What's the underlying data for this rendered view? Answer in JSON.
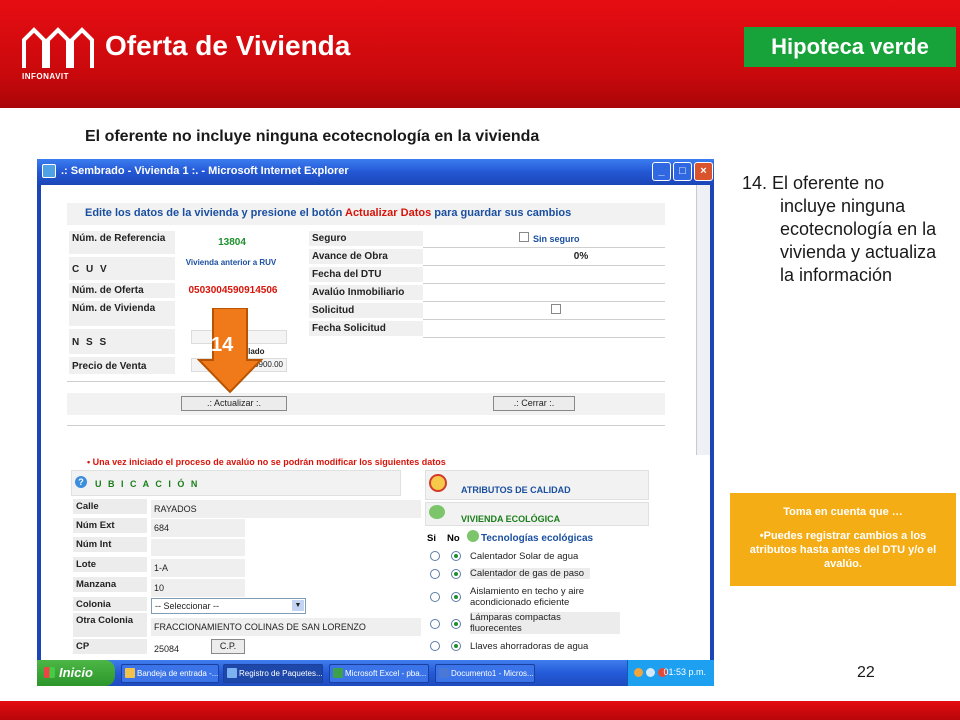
{
  "header": {
    "logo_text": "INFONAVIT",
    "title": "Oferta de Vivienda",
    "badge": "Hipoteca verde",
    "colors": {
      "header_red": "#d40b0f",
      "badge_green": "#17a33a"
    }
  },
  "subtitle": "El oferente no incluye ninguna ecotecnología en la vivienda",
  "ie_window": {
    "title": ".: Sembrado - Vivienda 1 :. - Microsoft Internet Explorer",
    "instruction_prefix": "Edite los datos de la vivienda y presione el botón",
    "instruction_highlight": "Actualizar Datos",
    "instruction_suffix": "para guardar sus cambios",
    "fields_left": [
      {
        "label": "Núm. de Referencia",
        "value": "13804"
      },
      {
        "label": "C U V",
        "value": "Vivienda anterior a RUV"
      },
      {
        "label": "Núm. de Oferta",
        "value": "0503004590914506"
      },
      {
        "label": "Núm. de Vivienda",
        "value": ""
      },
      {
        "label": "N S S",
        "value": "sin vinculado"
      },
      {
        "label": "Precio de Venta",
        "value": "60900.00"
      }
    ],
    "fields_right": [
      {
        "label": "Seguro",
        "value": "Sin seguro"
      },
      {
        "label": "Avance de Obra",
        "value": "0%"
      },
      {
        "label": "Fecha del DTU",
        "value": ""
      },
      {
        "label": "Avalúo Inmobiliario",
        "value": ""
      },
      {
        "label": "Solicitud",
        "value": ""
      },
      {
        "label": "Fecha Solicitud",
        "value": ""
      }
    ],
    "buttons": {
      "update": ".: Actualizar :.",
      "close": ".: Cerrar :."
    },
    "warning": "Una vez iniciado el proceso de avalúo no se podrán modificar los siguientes datos",
    "location": {
      "title": "U B I C A C I Ó N",
      "fields": [
        {
          "label": "Calle",
          "value": "RAYADOS"
        },
        {
          "label": "Núm Ext",
          "value": "684"
        },
        {
          "label": "Núm Int",
          "value": ""
        },
        {
          "label": "Lote",
          "value": "1-A"
        },
        {
          "label": "Manzana",
          "value": "10"
        },
        {
          "label": "Colonia",
          "value": "-- Seleccionar --"
        },
        {
          "label": "Otra Colonia",
          "value": "FRACCIONAMIENTO COLINAS DE SAN LORENZO"
        },
        {
          "label": "CP",
          "value": "25084"
        }
      ],
      "cp_button": "C.P."
    },
    "attributes": {
      "quality_title": "ATRIBUTOS DE CALIDAD",
      "eco_title": "VIVIENDA ECOLÓGICA",
      "col_yes": "Si",
      "col_no": "No",
      "tech_header": "Tecnologías ecológicas",
      "items": [
        "Calentador Solar de agua",
        "Calentador de gas de paso",
        "Aislamiento en techo y aire acondicionado eficiente",
        "Lámparas compactas fluorecentes",
        "Llaves ahorradoras de agua"
      ]
    },
    "taskbar": {
      "start": "Inicio",
      "tasks": [
        "Bandeja de entrada -...",
        "Registro de Paquetes...",
        "Microsoft Excel - pba...",
        "Documento1 - Micros..."
      ],
      "clock": "01:53 p.m."
    }
  },
  "callout": {
    "label": "14",
    "color": "#f07a1a"
  },
  "step": {
    "text_line1": "14. El oferente no",
    "text_rest": "incluye ninguna ecotecnología en la vivienda y actualiza la información"
  },
  "note": {
    "heading": "Toma en cuenta que …",
    "body": "•Puedes registrar cambios a los atributos hasta antes del DTU y/o el avalúo.",
    "color": "#f5ad16"
  },
  "page_number": "22"
}
